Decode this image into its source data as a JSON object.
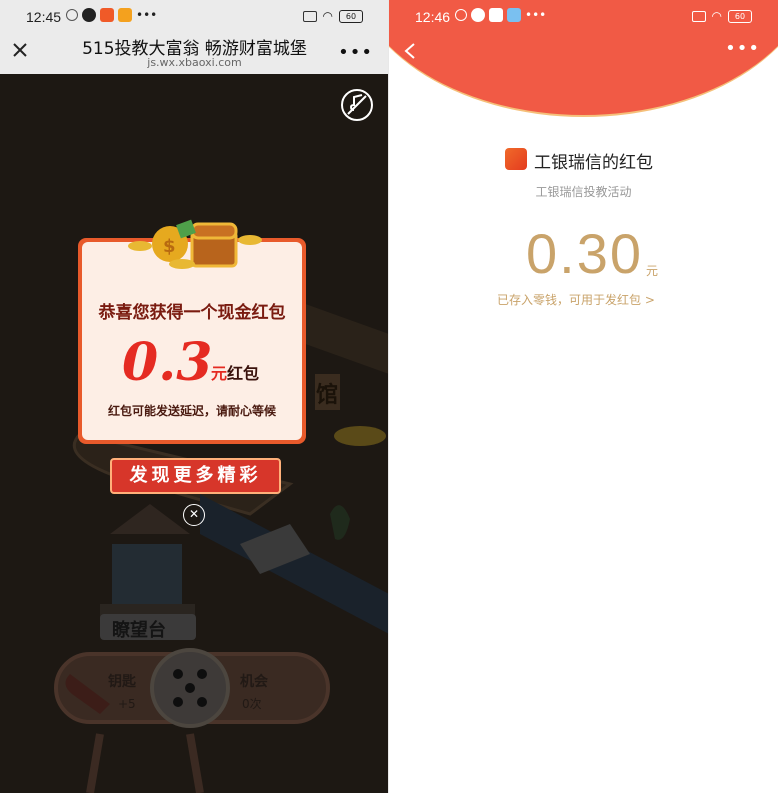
{
  "left": {
    "status": {
      "time": "12:45",
      "battery": "60"
    },
    "header": {
      "title": "515投教大富翁 畅游财富城堡",
      "url": "js.wx.xbaoxi.com"
    },
    "popup": {
      "title": "恭喜您获得一个现金红包",
      "amount": "0.3",
      "unit": "元",
      "unit_suffix": "红包",
      "note": "红包可能发送延迟，请耐心等候",
      "button": "发现更多精彩"
    },
    "game": {
      "building_label": "馆",
      "tower_label": "瞭望台",
      "left_btn": "钥匙",
      "left_count": "+5",
      "right_btn": "机会",
      "right_count": "0次"
    }
  },
  "right": {
    "status": {
      "time": "12:46",
      "battery": "60"
    },
    "sender": "工银瑞信的红包",
    "subtitle": "工银瑞信投教活动",
    "amount": "0.30",
    "unit": "元",
    "link": "已存入零钱，可用于发红包",
    "link_arrow": ">"
  },
  "colors": {
    "accent_red": "#f15a45",
    "gold": "#c9a36a",
    "popup_red": "#e52b22"
  }
}
